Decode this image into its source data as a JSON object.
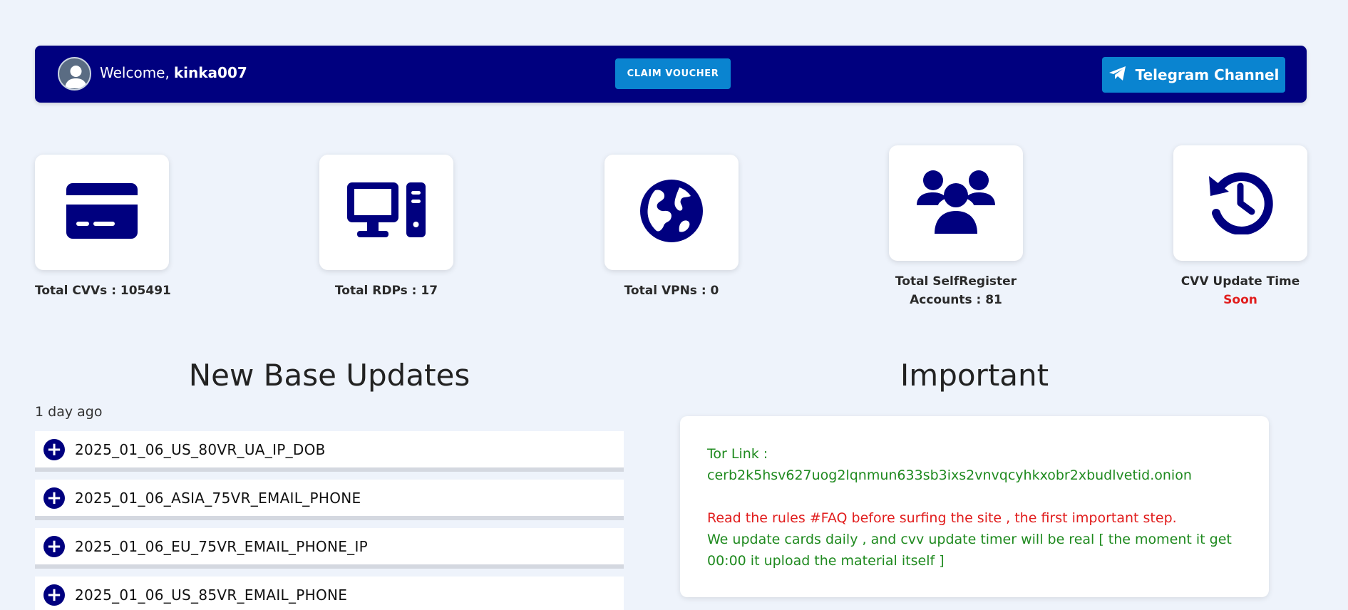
{
  "header": {
    "welcome_label": "Welcome,",
    "username": "kinka007",
    "claim_button": "CLAIM VOUCHER",
    "telegram_button": "Telegram Channel"
  },
  "stats": [
    {
      "label": "Total CVVs : 105491",
      "icon": "credit-card-icon"
    },
    {
      "label": "Total RDPs : 17",
      "icon": "desktop-computer-icon"
    },
    {
      "label": "Total VPNs : 0",
      "icon": "globe-icon"
    },
    {
      "label": "Total SelfRegister Accounts : 81",
      "icon": "users-group-icon"
    },
    {
      "label": "CVV Update Time",
      "value": "Soon",
      "icon": "history-clock-icon"
    }
  ],
  "updates": {
    "title": "New Base Updates",
    "time_ago": "1 day ago",
    "items": [
      "2025_01_06_US_80VR_UA_IP_DOB",
      "2025_01_06_ASIA_75VR_EMAIL_PHONE",
      "2025_01_06_EU_75VR_EMAIL_PHONE_IP",
      "2025_01_06_US_85VR_EMAIL_PHONE"
    ]
  },
  "important": {
    "title": "Important",
    "tor_label": "Tor Link :",
    "tor_link": "cerb2k5hsv627uog2lqnmun633sb3ixs2vnvqcyhkxobr2xbudlvetid.onion",
    "rules_text": "Read the rules #FAQ before surfing the site , the first important step.",
    "update_text": "We update cards daily , and cvv update timer will be real [ the moment it get 00:00 it upload the material itself ]"
  },
  "colors": {
    "navy": "#00007f",
    "button_blue": "#0a84d0",
    "alert_red": "#e11d1d",
    "info_green": "#1f8a1f",
    "page_bg": "#eef3fb"
  }
}
